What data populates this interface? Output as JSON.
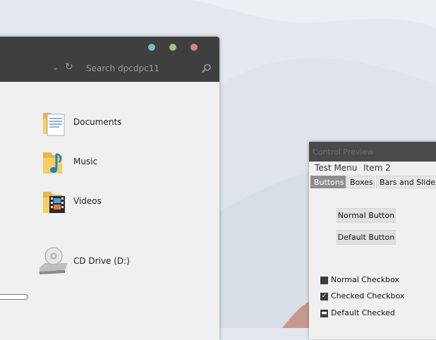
{
  "explorer": {
    "search_placeholder": "Search dpcdpc11",
    "items": [
      {
        "label": "Documents"
      },
      {
        "label": "Music"
      },
      {
        "label": "Videos"
      },
      {
        "label": "CD Drive (D:)"
      }
    ]
  },
  "preview": {
    "title": "Control Preview",
    "menu": [
      "Test Menu",
      "Item 2"
    ],
    "tabs": [
      "Buttons",
      "Boxes",
      "Bars and Sliders"
    ],
    "buttons": {
      "normal": "Normal Button",
      "default": "Default Button"
    },
    "checkboxes": [
      {
        "label": "Normal Checkbox",
        "state": "unchecked"
      },
      {
        "label": "Checked Checkbox",
        "state": "checked"
      },
      {
        "label": "Default Checked",
        "state": "indeterminate"
      }
    ]
  },
  "colors": {
    "titlebar": "#3f3f3f",
    "window_bg": "#f0f0f0",
    "minimize_dot": "#7fbcc6",
    "maximize_dot": "#a2c481",
    "close_dot": "#d78777",
    "active_tab": "#8f8f8f"
  }
}
